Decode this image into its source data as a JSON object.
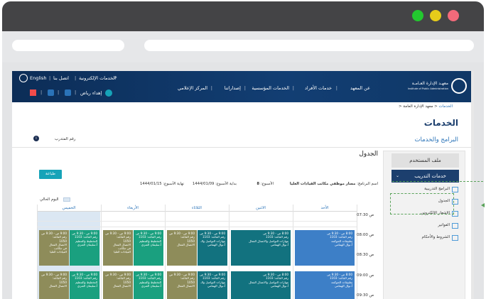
{
  "window": {
    "controls": {
      "green": "#23c72f",
      "yellow": "#e6cc1a",
      "red": "#f36a7a"
    }
  },
  "topnav": {
    "logo_ar": "معهـد الإدارة العـامـة",
    "logo_en": "Institute of Public Administration",
    "menu": [
      "عن المعهد",
      "خدمات الأفراد",
      "الخدمات المؤسسية",
      "إصداراتنا",
      "المركز الإعلامي"
    ],
    "utility": [
      "الخدمات الإلكترونية",
      "اتصل بنا",
      "English"
    ],
    "user": "إهداء رياض"
  },
  "breadcrumb": {
    "home": "معهد الإدارة العامة",
    "current": "الخدمات"
  },
  "page": {
    "title": "الخدمات",
    "subtitle": "البرامج والخدمات",
    "trainee_label": "رقم المتدرب",
    "section_title": "الجدول",
    "print_label": "طباعة"
  },
  "sidebar": {
    "profile": "ملف المستخدم",
    "active": "خدمات التدريب",
    "items": [
      "البرامج التدريبية",
      "الجدول",
      "الإشعار الإلكتروني",
      "الفواتير",
      "الشروط والأحكام"
    ]
  },
  "meta": {
    "program_label": "اسم البرنامج:",
    "program_value": "مسار موظفي مكاتب القيادات العليا",
    "week_label": "الأسبوع:",
    "week_value": "8",
    "start_label": "بداية الأسبوع:",
    "start_value": "1444/01/09",
    "end_label": "نهاية الأسبوع:",
    "end_value": "1444/01/15",
    "today_label": "اليوم الحالي"
  },
  "calendar": {
    "days": [
      "الأحد",
      "الاثنين",
      "الثلاثاء",
      "الأربعاء",
      "الخميس"
    ],
    "times": [
      "07:30 ص",
      "08:00 ص",
      "08:30 ص",
      "09:00 ص",
      "09:30 ص"
    ],
    "events": {
      "sun1": [
        "8:00 ص - 9:30 ص",
        "رقم القاعة: 1103",
        "تطبيقات الحوكمة",
        "أ.نوال الهمامي"
      ],
      "mon1": [
        "8:00 ص - 9:30 ص",
        "رقم القاعة: 1103",
        "مهارات التواصل والاتصال الفعال",
        "أ.نوال الهمامي"
      ],
      "tue1a": [
        "9:00 ص - 9:30 ص",
        "رقم القاعة: 1103",
        "مهارات التواصل والـ",
        "أ.نوال الهمامي"
      ],
      "tue1b": [
        "9:00 ص - 9:30 ص",
        "رقم القاعة:",
        "1050",
        "الاتصال الفعال"
      ],
      "wed1a": [
        "9:00 ص - 9:30 ص",
        "رقم القاعة: 1103",
        "التخطيط والتنظيم",
        "أ.سليمان العنزي"
      ],
      "wed1b": [
        "9:00 ص - 9:30 ص",
        "رقم القاعة:",
        "1050",
        "الاتصال الفعال",
        "في مكاتب",
        "القيادات العليا"
      ],
      "thu1a": [
        "9:00 ص - 9:30 ص",
        "رقم القاعة: 1103",
        "التخطيط والتنظيم",
        "أ.سليمان العنزي"
      ],
      "thu1b": [
        "9:00 ص - 9:30 ص",
        "رقم القاعة:",
        "1050",
        "الاتصال الفعال",
        "في مكاتب",
        "القيادات العليا"
      ],
      "sun2": [
        "8:00 ص - 9:30 ص",
        "رقم القاعة: 1103",
        "تطبيقات الحوكمة",
        "أ.نوال الهمامي"
      ],
      "mon2": [
        "8:00 ص - 9:30 ص",
        "رقم القاعة: 1103",
        "مهارات التواصل والاتصال الفعال",
        "أ.نوال الهمامي"
      ],
      "tue2a": [
        "9:00 ص - 9:30 ص",
        "رقم القاعة: 1103",
        "مهارات التواصل والـ",
        "أ.نوال الهمامي"
      ],
      "tue2b": [
        "9:00 ص - 9:30 ص",
        "رقم القاعة:",
        "1050",
        "الاتصال الفعال"
      ],
      "wed2a": [
        "9:00 ص - 9:30 ص",
        "رقم القاعة: 1103",
        "التخطيط والتنظيم",
        "أ.سليمان العنزي"
      ],
      "wed2b": [
        "9:00 ص - 9:30 ص",
        "رقم القاعة:",
        "1050",
        "الاتصال الفعال"
      ],
      "thu2a": [
        "9:00 ص - 9:30 ص",
        "رقم القاعة: 1103",
        "التخطيط والتنظيم",
        "أ.سليمان العنزي"
      ],
      "thu2b": [
        "9:00 ص - 9:30 ص",
        "رقم القاعة:",
        "1050",
        "الاتصال الفعال"
      ]
    }
  }
}
